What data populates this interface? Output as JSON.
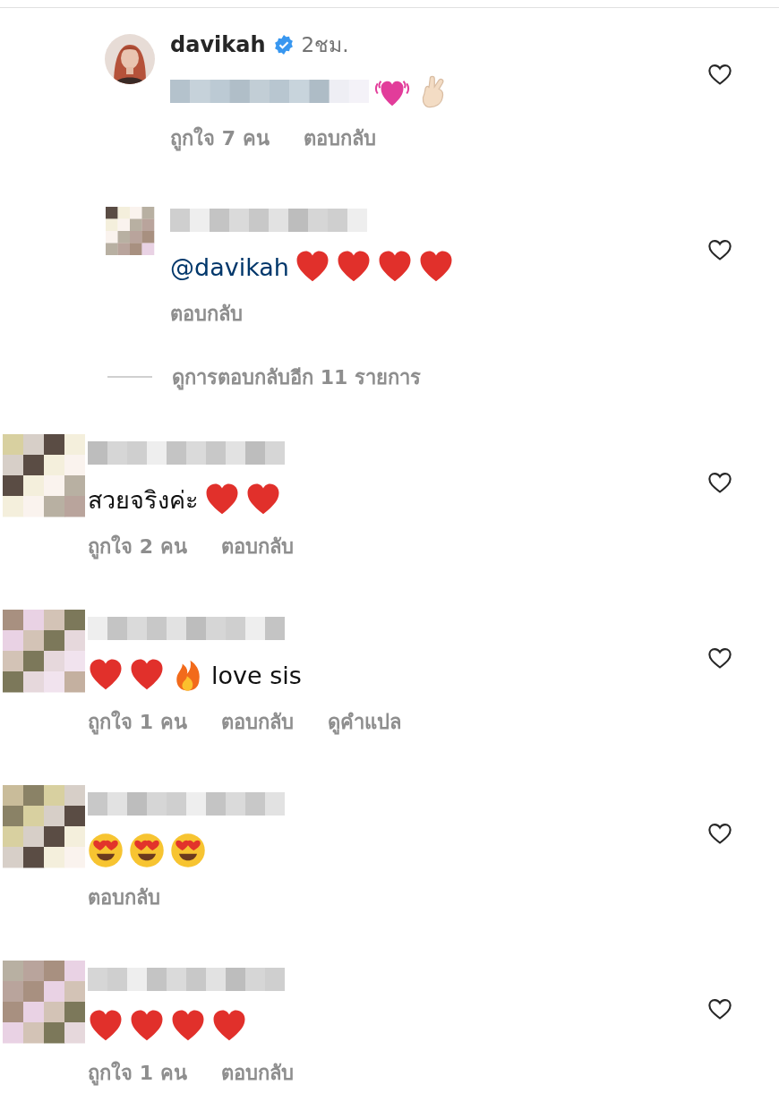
{
  "items": [
    {
      "kind": "comment",
      "reply": true,
      "avatar": {
        "kind": "picture"
      },
      "author": "davikah",
      "verified": true,
      "time": "2ชม.",
      "body": [
        {
          "kind": "blur"
        },
        {
          "kind": "sparkle-heart"
        },
        {
          "kind": "hand"
        }
      ],
      "actions": [
        "ถูกใจ 7 คน",
        "ตอบกลับ"
      ]
    },
    {
      "kind": "comment",
      "reply": true,
      "avatar": {
        "kind": "mosaic"
      },
      "body": [
        {
          "kind": "mention",
          "text": "@davikah"
        },
        {
          "kind": "heart"
        },
        {
          "kind": "heart"
        },
        {
          "kind": "heart"
        },
        {
          "kind": "heart"
        }
      ],
      "actions": [
        "ตอบกลับ"
      ]
    },
    {
      "kind": "more",
      "label": "ดูการตอบกลับอีก 11 รายการ"
    },
    {
      "kind": "comment",
      "reply": false,
      "avatar": {
        "kind": "mosaic"
      },
      "body": [
        {
          "kind": "text",
          "text": "สวยจริงค่ะ"
        },
        {
          "kind": "heart"
        },
        {
          "kind": "heart"
        }
      ],
      "actions": [
        "ถูกใจ 2 คน",
        "ตอบกลับ"
      ]
    },
    {
      "kind": "comment",
      "reply": false,
      "avatar": {
        "kind": "mosaic"
      },
      "body": [
        {
          "kind": "heart"
        },
        {
          "kind": "heart"
        },
        {
          "kind": "fire"
        },
        {
          "kind": "text",
          "text": "love sis"
        }
      ],
      "actions": [
        "ถูกใจ 1 คน",
        "ตอบกลับ",
        "ดูคำแปล"
      ]
    },
    {
      "kind": "comment",
      "reply": false,
      "avatar": {
        "kind": "mosaic"
      },
      "body": [
        {
          "kind": "heart-eyes"
        },
        {
          "kind": "heart-eyes"
        },
        {
          "kind": "heart-eyes"
        }
      ],
      "actions": [
        "ตอบกลับ"
      ]
    },
    {
      "kind": "comment",
      "reply": false,
      "avatar": {
        "kind": "mosaic"
      },
      "body": [
        {
          "kind": "heart"
        },
        {
          "kind": "heart"
        },
        {
          "kind": "heart"
        },
        {
          "kind": "heart"
        }
      ],
      "actions": [
        "ถูกใจ 1 คน",
        "ตอบกลับ"
      ]
    }
  ]
}
